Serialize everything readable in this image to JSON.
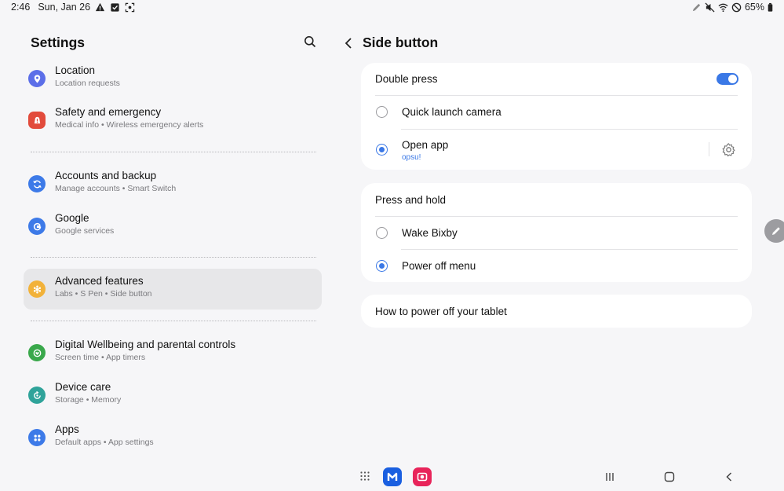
{
  "status_bar": {
    "time": "2:46",
    "date": "Sun, Jan 26",
    "battery": "65%"
  },
  "left": {
    "title": "Settings",
    "items": [
      {
        "title": "Location",
        "subtitle": "Location requests",
        "icon": "location-icon",
        "color": "#5b6ee8"
      },
      {
        "title": "Safety and emergency",
        "subtitle": "Medical info  •  Wireless emergency alerts",
        "icon": "emergency-icon",
        "color": "#e24b3c"
      },
      {
        "title": "Accounts and backup",
        "subtitle": "Manage accounts  •  Smart Switch",
        "icon": "sync-icon",
        "color": "#3d7ae8"
      },
      {
        "title": "Google",
        "subtitle": "Google services",
        "icon": "google-icon",
        "color": "#3d7ae8"
      },
      {
        "title": "Advanced features",
        "subtitle": "Labs  •  S Pen  •  Side button",
        "icon": "advanced-features-icon",
        "color": "#f2b23a"
      },
      {
        "title": "Digital Wellbeing and parental controls",
        "subtitle": "Screen time  •  App timers",
        "icon": "wellbeing-icon",
        "color": "#3aa84b"
      },
      {
        "title": "Device care",
        "subtitle": "Storage  •  Memory",
        "icon": "device-care-icon",
        "color": "#2fa39a"
      },
      {
        "title": "Apps",
        "subtitle": "Default apps  •  App settings",
        "icon": "apps-icon",
        "color": "#3d7ae8"
      }
    ]
  },
  "right": {
    "title": "Side button",
    "double_press": {
      "label": "Double press",
      "enabled": true,
      "options": [
        {
          "label": "Quick launch camera",
          "selected": false
        },
        {
          "label": "Open app",
          "sub": "opsu!",
          "selected": true
        }
      ]
    },
    "press_and_hold": {
      "label": "Press and hold",
      "options": [
        {
          "label": "Wake Bixby",
          "selected": false
        },
        {
          "label": "Power off menu",
          "selected": true
        }
      ]
    },
    "help_link": "How to power off your tablet"
  },
  "colors": {
    "accent": "#3a78e6",
    "background": "#f6f6f8",
    "card": "#ffffff",
    "selected_item": "#e7e7e9"
  }
}
